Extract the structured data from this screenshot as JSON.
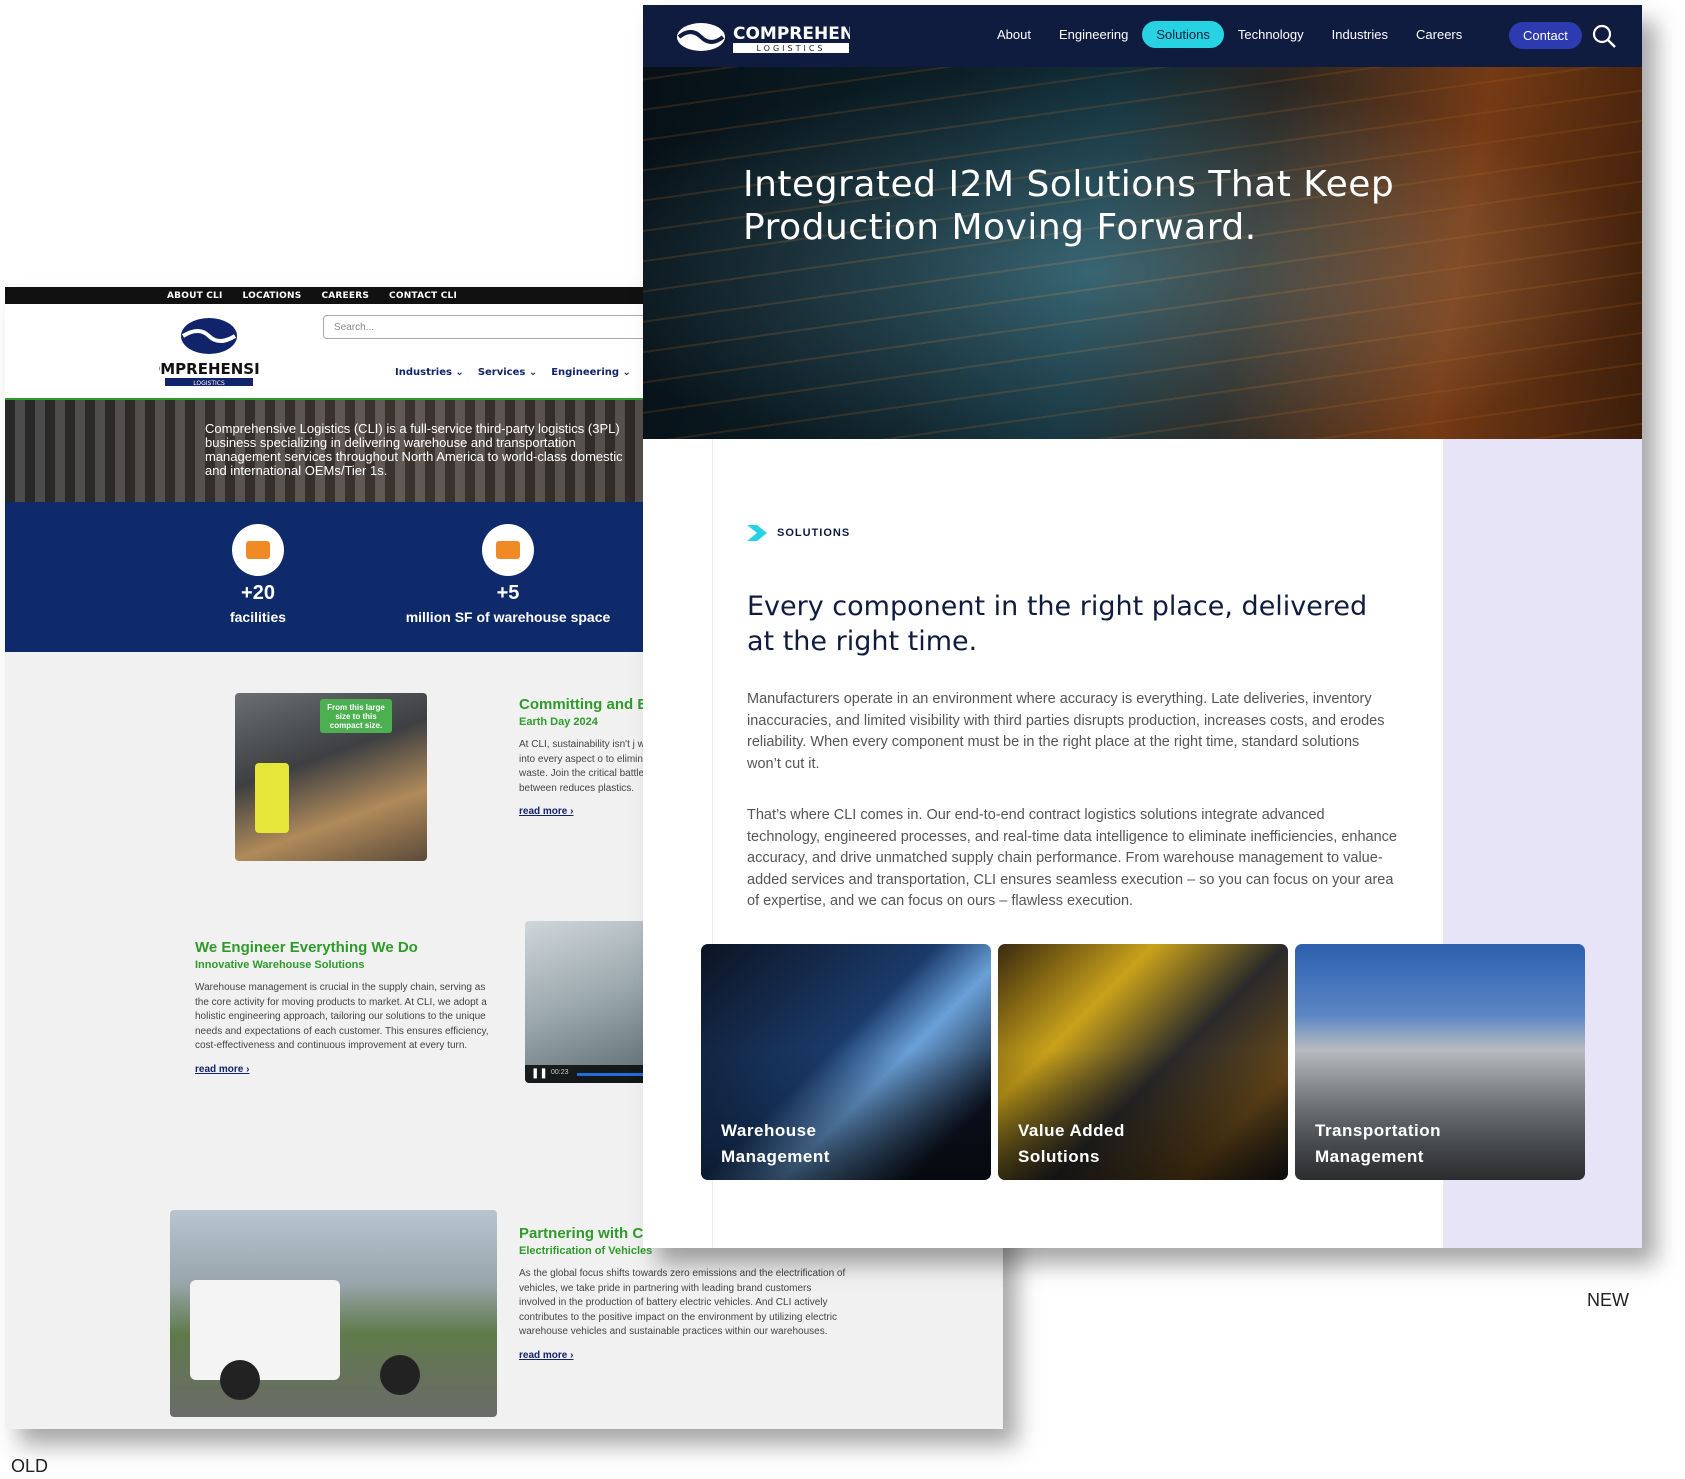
{
  "labels": {
    "old": "OLD",
    "new": "NEW"
  },
  "old_site": {
    "top_links": [
      "ABOUT CLI",
      "LOCATIONS",
      "CAREERS",
      "CONTACT CLI"
    ],
    "search_placeholder": "Search...",
    "nav": [
      "Industries ⌄",
      "Services ⌄",
      "Engineering ⌄"
    ],
    "hero_text": "Comprehensive Logistics (CLI) is a full-service third-party logistics (3PL) business specializing in delivering warehouse and transportation management services throughout North America to world-class domestic and international OEMs/Tier 1s.",
    "stats": [
      {
        "value": "+20",
        "label": "facilities"
      },
      {
        "value": "+5",
        "label": "million SF of warehouse space"
      }
    ],
    "sections": [
      {
        "title": "Committing and Best Practices fo",
        "subtitle": "Earth Day 2024",
        "body": "At CLI, sustainability isn't j woven into every aspect o to eliminating waste. Join the critical battle between reduces plastics.",
        "more": "read more ›",
        "image_caption": "From this large size to this compact size."
      },
      {
        "title": "We Engineer Everything We Do",
        "subtitle": "Innovative Warehouse Solutions",
        "body": "Warehouse management is crucial in the supply chain, serving as the core activity for moving products to market. At CLI, we adopt a holistic engineering approach, tailoring our solutions to the unique needs and expectations of each customer. This ensures efficiency, cost-effectiveness and continuous improvement at every turn.",
        "more": "read more ›",
        "video_time": "00:23"
      },
      {
        "title": "Partnering with C",
        "subtitle": "Electrification of Vehicles",
        "body": "As the global focus shifts towards zero emissions and the electrification of vehicles, we take pride in partnering with leading brand customers involved in the production of battery electric vehicles. And CLI actively contributes to the positive impact on the environment by utilizing electric warehouse vehicles and sustainable practices within our warehouses.",
        "more": "read more ›"
      }
    ]
  },
  "new_site": {
    "logo_word": "COMPREHENSIVE",
    "logo_sub": "LOGISTICS",
    "nav": [
      "About",
      "Engineering",
      "Solutions",
      "Technology",
      "Industries",
      "Careers"
    ],
    "active_nav": "Solutions",
    "contact": "Contact",
    "hero_title": "Integrated I2M Solutions That Keep Production Moving Forward.",
    "eyebrow": "SOLUTIONS",
    "heading": "Every component in the right place, delivered at the right time.",
    "para1": "Manufacturers operate in an environment where accuracy is everything. Late deliveries, inventory inaccuracies, and limited visibility with third parties disrupts production, increases costs, and erodes reliability. When every component must be in the right place at the right time, standard solutions won’t cut it.",
    "para2": "That’s where CLI comes in. Our end-to-end contract logistics solutions integrate advanced technology, engineered processes, and real-time data intelligence to eliminate inefficiencies, enhance accuracy, and drive unmatched supply chain performance. From warehouse management to value-added services and transportation, CLI ensures seamless execution – so you can focus on your area of expertise, and we can focus on ours – flawless execution.",
    "cards": [
      {
        "line1": "Warehouse",
        "line2": "Management"
      },
      {
        "line1": "Value Added",
        "line2": "Solutions"
      },
      {
        "line1": "Transportation",
        "line2": "Management"
      }
    ]
  },
  "colors": {
    "navy": "#0f1c40",
    "accent": "#27d3e3",
    "contact": "#2d3bb0",
    "old_green": "#2e9b2a",
    "old_navy": "#0f2a6b"
  }
}
